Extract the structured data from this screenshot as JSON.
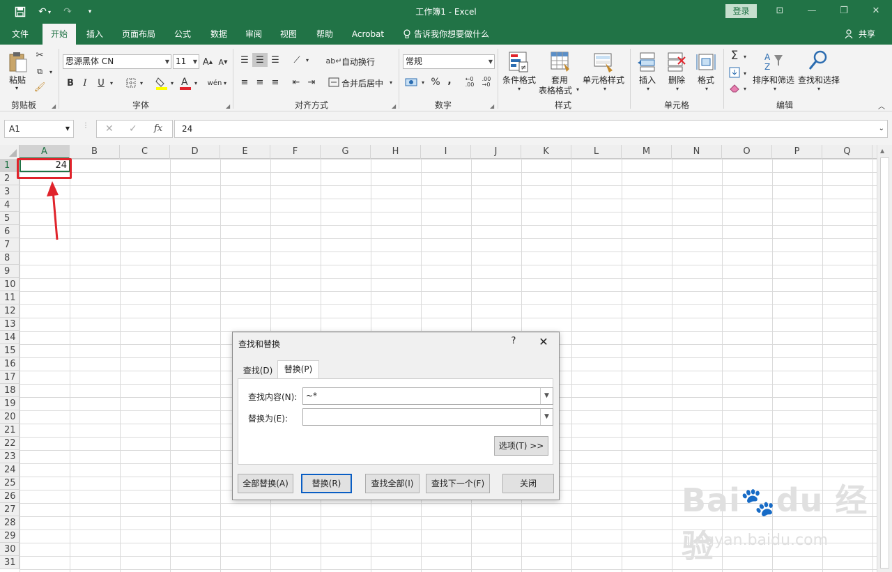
{
  "window": {
    "title": "工作簿1  -  Excel",
    "login": "登录"
  },
  "qat": {
    "save_icon": "save-icon",
    "undo_icon": "undo-icon",
    "redo_icon": "redo-icon"
  },
  "tabs": [
    "文件",
    "开始",
    "插入",
    "页面布局",
    "公式",
    "数据",
    "审阅",
    "视图",
    "帮助",
    "Acrobat"
  ],
  "tell_me": "告诉我你想要做什么",
  "share": "共享",
  "ribbon": {
    "clipboard": {
      "paste": "粘贴",
      "label": "剪贴板"
    },
    "font": {
      "name": "思源黑体 CN",
      "size": "11",
      "label": "字体",
      "bold": "B",
      "italic": "I",
      "underline": "U"
    },
    "alignment": {
      "wrap": "自动换行",
      "merge": "合并后居中",
      "label": "对齐方式"
    },
    "number": {
      "format": "常规",
      "label": "数字",
      "percent": "%",
      "comma": ","
    },
    "styles": {
      "conditional": "条件格式",
      "table_line1": "套用",
      "table_line2": "表格格式",
      "cell_styles": "单元格样式",
      "label": "样式"
    },
    "cells": {
      "insert": "插入",
      "delete": "删除",
      "format": "格式",
      "label": "单元格"
    },
    "editing": {
      "sort": "排序和筛选",
      "find": "查找和选择",
      "label": "编辑"
    }
  },
  "formula_bar": {
    "name_box": "A1",
    "fx": "fx",
    "value": "24"
  },
  "columns": [
    "A",
    "B",
    "C",
    "D",
    "E",
    "F",
    "G",
    "H",
    "I",
    "J",
    "K",
    "L",
    "M",
    "N",
    "O",
    "P",
    "Q"
  ],
  "rows": [
    "1",
    "2",
    "3",
    "4",
    "5",
    "6",
    "7",
    "8",
    "9",
    "10",
    "11",
    "12",
    "13",
    "14",
    "15",
    "16",
    "17",
    "18",
    "19",
    "20",
    "21",
    "22",
    "23",
    "24",
    "25",
    "26",
    "27",
    "28",
    "29",
    "30",
    "31"
  ],
  "cell_a1": "24",
  "dialog": {
    "title": "查找和替换",
    "help": "?",
    "tab_find": "查找(D)",
    "tab_replace": "替换(P)",
    "find_label": "查找内容(N):",
    "find_value": "~*",
    "replace_label": "替换为(E):",
    "replace_value": "",
    "options": "选项(T) >>",
    "replace_all": "全部替换(A)",
    "replace": "替换(R)",
    "find_all": "查找全部(I)",
    "find_next": "查找下一个(F)",
    "close": "关闭"
  },
  "watermark": {
    "text": "Bai du 经验",
    "url": "jingyan.baidu.com"
  },
  "colors": {
    "excel_green": "#217346",
    "highlight_red": "#e0232b"
  }
}
